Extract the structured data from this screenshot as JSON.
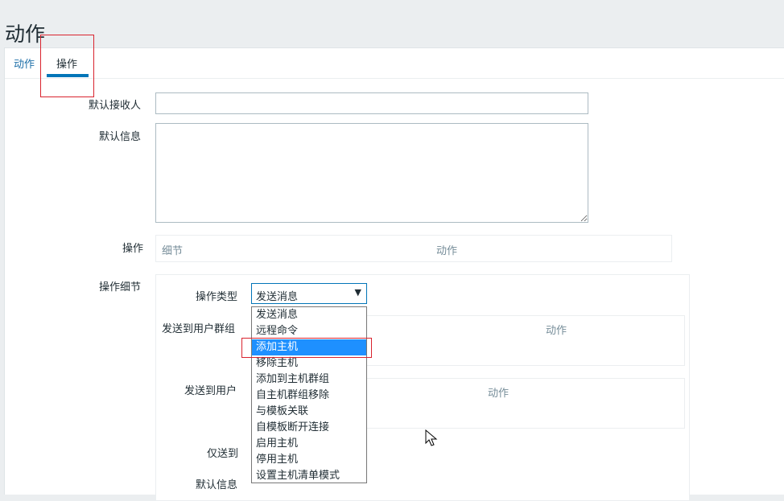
{
  "page": {
    "title": "动作"
  },
  "tabs": [
    {
      "label": "动作"
    },
    {
      "label": "操作"
    }
  ],
  "form": {
    "default_recipient_label": "默认接收人",
    "default_recipient_value": "",
    "default_message_label": "默认信息",
    "default_message_value": "",
    "operations_label": "操作",
    "operations_table": {
      "col_details": "细节",
      "col_action": "动作"
    },
    "operation_details_label": "操作细节",
    "operation_type_label": "操作类型",
    "operation_type_value": "发送消息",
    "send_to_groups_label": "发送到用户群组",
    "send_to_groups_col_action": "动作",
    "send_to_users_label": "发送到用户",
    "send_to_users_col_action": "动作",
    "only_send_to_label": "仅送到",
    "default_info_label": "默认信息"
  },
  "dropdown": {
    "options": [
      "发送消息",
      "远程命令",
      "添加主机",
      "移除主机",
      "添加到主机群组",
      "自主机群组移除",
      "与模板关联",
      "自模板断开连接",
      "启用主机",
      "停用主机",
      "设置主机清单模式"
    ],
    "highlighted": "添加主机"
  },
  "icons": {
    "select_arrow": "triangle-down-icon",
    "mouse_cursor": "mouse-pointer-icon"
  },
  "colors": {
    "accent": "#0275b8",
    "link": "#1e6fa8",
    "highlight": "#1e90ff",
    "annotation": "#d9232e"
  }
}
